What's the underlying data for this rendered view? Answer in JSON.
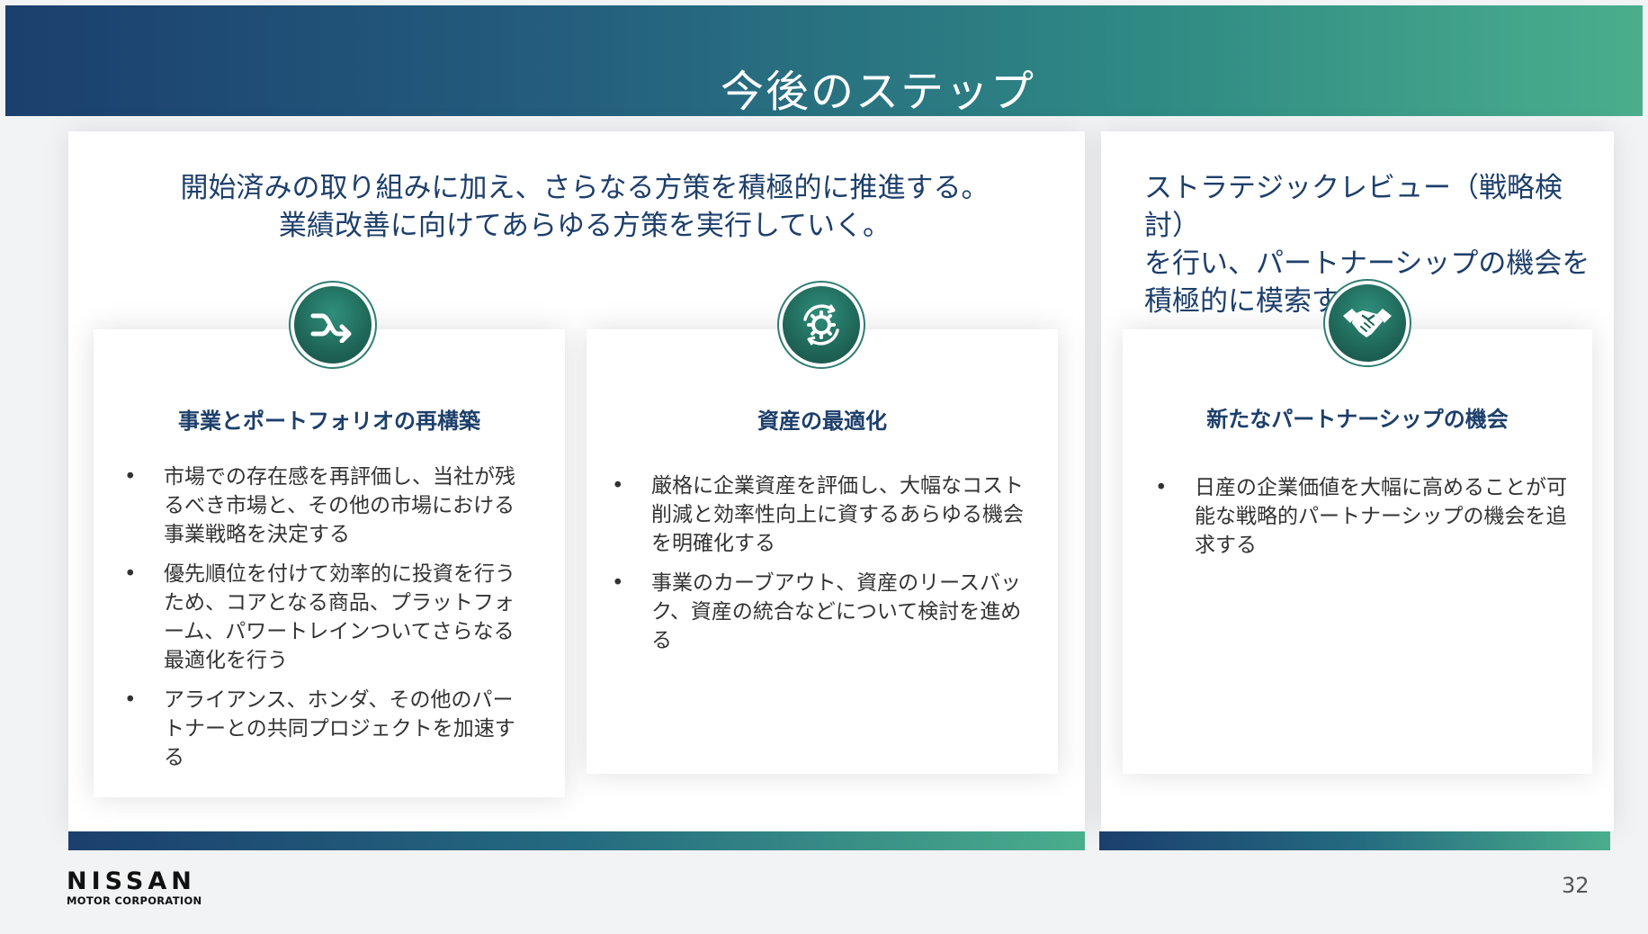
{
  "header": {
    "title": "今後のステップ"
  },
  "left": {
    "lead_line1": "開始済みの取り組みに加え、さらなる方策を積極的に推進する。",
    "lead_line2": "業績改善に向けてあらゆる方策を実行していく。"
  },
  "right": {
    "lead_line1": "ストラテジックレビュー（戦略検討）",
    "lead_line2": "を行い、パートナーシップの機会を",
    "lead_line3": "積極的に模索する"
  },
  "cards": [
    {
      "icon": "merge-arrow-icon",
      "title": "事業とポートフォリオの再構築",
      "bullets": [
        "市場での存在感を再評価し、当社が残るべき市場と、その他の市場における事業戦略を決定する",
        "優先順位を付けて効率的に投資を行うため、コアとなる商品、プラットフォーム、パワートレインついてさらなる最適化を行う",
        "アライアンス、ホンダ、その他のパートナーとの共同プロジェクトを加速する"
      ]
    },
    {
      "icon": "gear-cycle-icon",
      "title": "資産の最適化",
      "bullets": [
        "厳格に企業資産を評価し、大幅なコスト削減と効率性向上に資するあらゆる機会を明確化する",
        "事業のカーブアウト、資産のリースバック、資産の統合などについて検討を進める"
      ]
    },
    {
      "icon": "handshake-icon",
      "title": "新たなパートナーシップの機会",
      "bullets": [
        "日産の企業価値を大幅に高めることが可能な戦略的パートナーシップの機会を追求する"
      ]
    }
  ],
  "footer": {
    "logo_main": "NISSAN",
    "logo_sub": "MOTOR CORPORATION",
    "page_number": "32"
  },
  "colors": {
    "header_start": "#1b3f6e",
    "header_end": "#4aae8c",
    "icon_green": "#1f6658",
    "text_navy": "#1d3f6b"
  }
}
